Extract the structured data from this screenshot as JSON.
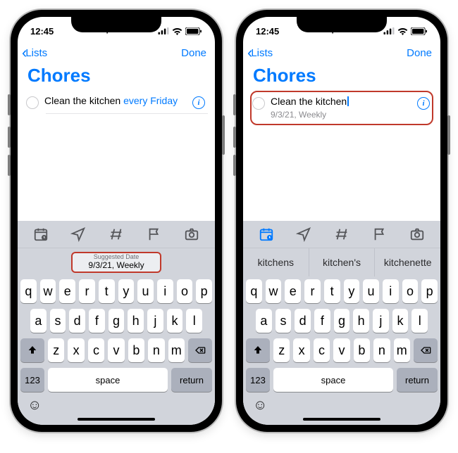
{
  "status": {
    "time": "12:45"
  },
  "nav": {
    "back": "Lists",
    "done": "Done"
  },
  "list_title": "Chores",
  "left": {
    "reminder_text": "Clean the kitchen ",
    "reminder_nl": "every Friday",
    "suggest_label": "Suggested Date",
    "suggest_value": "9/3/21, Weekly"
  },
  "right": {
    "reminder_text": "Clean the kitchen",
    "reminder_sub": "9/3/21, Weekly",
    "suggestions": [
      "kitchens",
      "kitchen's",
      "kitchenette"
    ]
  },
  "kb": {
    "row1": [
      "q",
      "w",
      "e",
      "r",
      "t",
      "y",
      "u",
      "i",
      "o",
      "p"
    ],
    "row2": [
      "a",
      "s",
      "d",
      "f",
      "g",
      "h",
      "j",
      "k",
      "l"
    ],
    "row3": [
      "z",
      "x",
      "c",
      "v",
      "b",
      "n",
      "m"
    ],
    "num": "123",
    "space": "space",
    "return": "return"
  }
}
